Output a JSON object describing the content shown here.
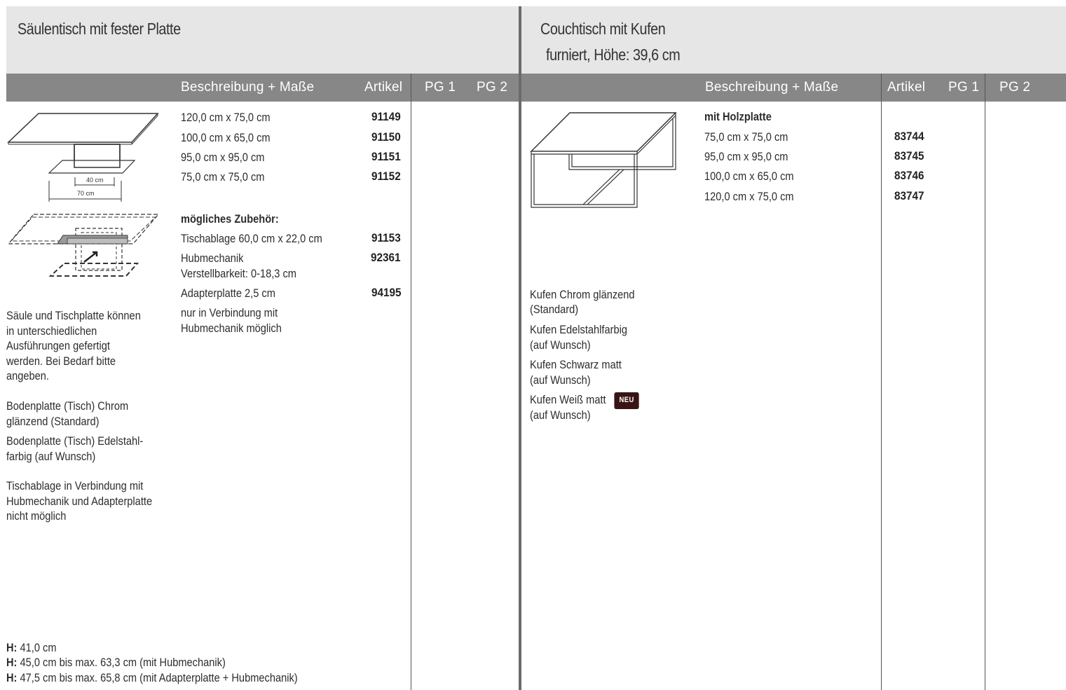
{
  "left": {
    "title": "Säulentisch mit fester Platte",
    "headers": {
      "desc": "Beschreibung + Maße",
      "article": "Artikel",
      "pg1": "PG 1",
      "pg2": "PG 2"
    },
    "sizes": [
      {
        "label": "120,0 cm x 75,0 cm",
        "article": "91149"
      },
      {
        "label": "100,0 cm x 65,0 cm",
        "article": "91150"
      },
      {
        "label": "95,0 cm x 95,0 cm",
        "article": "91151"
      },
      {
        "label": "75,0 cm x 75,0 cm",
        "article": "91152"
      }
    ],
    "accessories_heading": "mögliches Zubehör:",
    "accessories": [
      {
        "label": "Tischablage 60,0 cm x 22,0 cm",
        "article": "91153"
      },
      {
        "label": "Hubmechanik",
        "sub": "Verstellbarkeit: 0-18,3 cm",
        "article": "92361"
      },
      {
        "label": "Adapterplatte 2,5 cm",
        "article": "94195"
      }
    ],
    "adapter_note": [
      "nur in Verbindung mit",
      "Hubmechanik möglich"
    ],
    "diagram_labels": {
      "inner": "40 cm",
      "outer": "70 cm"
    },
    "notes": [
      [
        "Säule und Tischplatte können",
        "in unterschiedlichen",
        "Ausführungen gefertigt",
        "werden. Bei Bedarf bitte",
        "angeben."
      ],
      [
        "Bodenplatte (Tisch) Chrom",
        "glänzend (Standard)"
      ],
      [
        "Bodenplatte (Tisch) Edelstahl-",
        "farbig (auf Wunsch)"
      ],
      [
        "Tischablage in Verbindung mit",
        "Hubmechanik und Adapterplatte",
        "nicht möglich"
      ]
    ],
    "heights": [
      {
        "prefix": "H:",
        "text": " 41,0 cm"
      },
      {
        "prefix": "H:",
        "text": " 45,0 cm bis max. 63,3 cm (mit Hubmechanik)"
      },
      {
        "prefix": "H:",
        "text": " 47,5 cm bis max. 65,8 cm (mit Adapterplatte + Hubmechanik)"
      }
    ]
  },
  "right": {
    "title": "Couchtisch mit Kufen",
    "subtitle": "furniert, Höhe: 39,6 cm",
    "headers": {
      "desc": "Beschreibung + Maße",
      "article": "Artikel",
      "pg1": "PG 1",
      "pg2": "PG 2"
    },
    "group_heading": "mit Holzplatte",
    "sizes": [
      {
        "label": "75,0 cm x 75,0 cm",
        "article": "83744"
      },
      {
        "label": "95,0 cm x 95,0 cm",
        "article": "83745"
      },
      {
        "label": "100,0 cm x 65,0 cm",
        "article": "83746"
      },
      {
        "label": "120,0 cm x 75,0 cm",
        "article": "83747"
      }
    ],
    "finishes": [
      [
        "Kufen Chrom glänzend",
        "(Standard)"
      ],
      [
        "Kufen Edelstahlfarbig",
        "(auf Wunsch)"
      ],
      [
        "Kufen Schwarz matt",
        "(auf Wunsch)"
      ],
      [
        "Kufen Weiß matt",
        "(auf Wunsch)"
      ]
    ],
    "new_badge": "NEU"
  }
}
